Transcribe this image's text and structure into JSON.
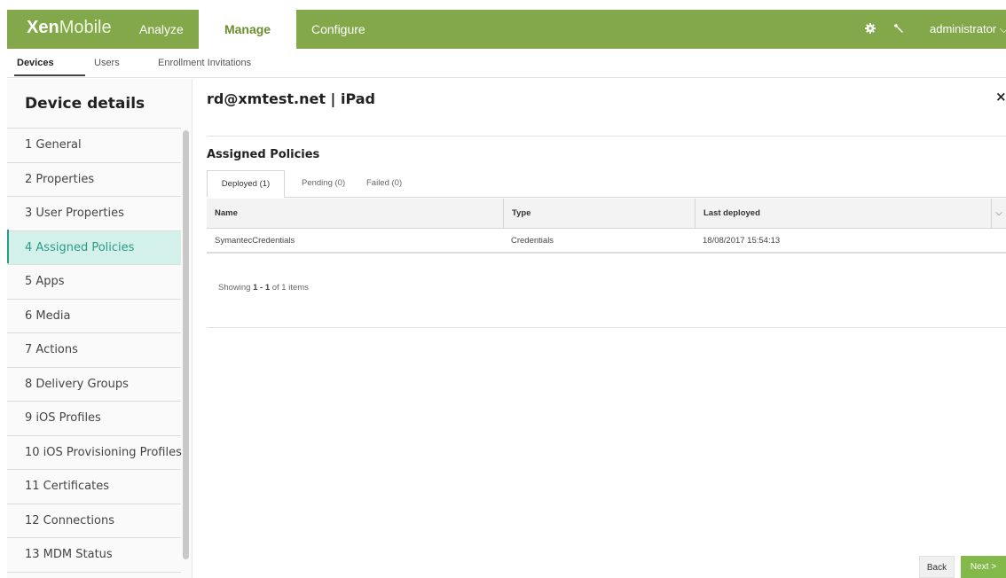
{
  "app": {
    "logo_bold": "Xen",
    "logo_thin": "Mobile"
  },
  "topnav": {
    "items": [
      {
        "label": "Analyze"
      },
      {
        "label": "Manage"
      },
      {
        "label": "Configure"
      }
    ],
    "settings_icon": "gear-icon",
    "tools_icon": "wrench-icon",
    "user_label": "administrator",
    "user_chevron": "⌵"
  },
  "subnav": {
    "tabs": [
      {
        "label": "Devices"
      },
      {
        "label": "Users"
      },
      {
        "label": "Enrollment Invitations"
      }
    ]
  },
  "sidebar": {
    "title": "Device details",
    "items": [
      {
        "label": "1  General"
      },
      {
        "label": "2  Properties"
      },
      {
        "label": "3  User Properties"
      },
      {
        "label": "4  Assigned Policies"
      },
      {
        "label": "5  Apps"
      },
      {
        "label": "6  Media"
      },
      {
        "label": "7  Actions"
      },
      {
        "label": "8  Delivery Groups"
      },
      {
        "label": "9  iOS Profiles"
      },
      {
        "label": "10  iOS Provisioning Profiles"
      },
      {
        "label": "11  Certificates"
      },
      {
        "label": "12  Connections"
      },
      {
        "label": "13  MDM Status"
      }
    ],
    "active_index": 3,
    "accent_color": "#2a9c86"
  },
  "main": {
    "title": "rd@xmtest.net | iPad",
    "close_glyph": "×",
    "section_title": "Assigned Policies",
    "tabs": [
      {
        "label": "Deployed (1)"
      },
      {
        "label": "Pending (0)"
      },
      {
        "label": "Failed (0)"
      }
    ],
    "table": {
      "headers": [
        "Name",
        "Type",
        "Last deployed"
      ],
      "rows": [
        {
          "name": "SymantecCredentials",
          "type": "Credentials",
          "last_deployed": "18/08/2017 15:54:13"
        }
      ],
      "chevron": "⌵"
    },
    "showing": {
      "prefix": "Showing ",
      "range": "1 - 1",
      "suffix": " of 1 items"
    }
  },
  "footer": {
    "back_label": "Back",
    "next_label": "Next >"
  },
  "colors": {
    "brand_green": "#82a84a",
    "next_button": "#82b94a"
  }
}
